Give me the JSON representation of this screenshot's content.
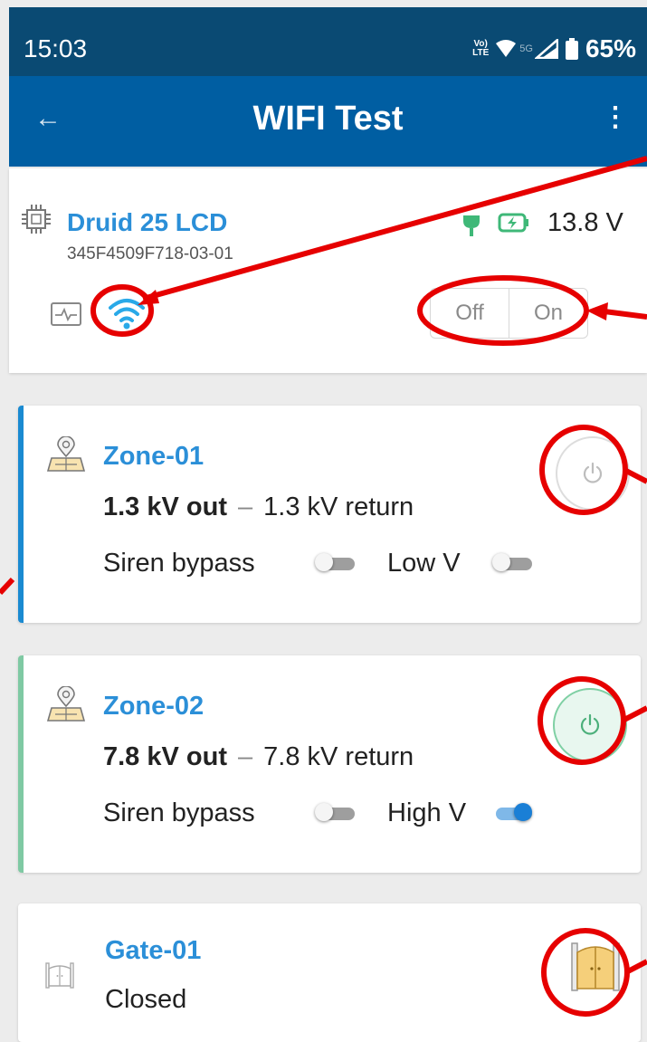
{
  "status_bar": {
    "time": "15:03",
    "volte": "Vo LTE",
    "net": "5G",
    "battery": "65%"
  },
  "app_bar": {
    "title": "WIFI Test",
    "back_icon": "arrow-left-icon",
    "menu_icon": "more-vert-icon"
  },
  "device": {
    "name": "Druid 25 LCD",
    "id": "345F4509F718-03-01",
    "voltage": "13.8 V",
    "segment": {
      "off": "Off",
      "on": "On"
    }
  },
  "zones": [
    {
      "name": "Zone-01",
      "out": "1.3 kV out",
      "dash": "–",
      "ret": "1.3 kV return",
      "opt1": "Siren bypass",
      "opt2": "Low V",
      "opt1_on": false,
      "opt2_on": false,
      "power": "off",
      "accent": "#1a8ad1"
    },
    {
      "name": "Zone-02",
      "out": "7.8 kV out",
      "dash": "–",
      "ret": "7.8 kV return",
      "opt1": "Siren bypass",
      "opt2": "High V",
      "opt1_on": false,
      "opt2_on": true,
      "power": "on",
      "accent": "#7fc9a3"
    }
  ],
  "gate": {
    "name": "Gate-01",
    "status": "Closed"
  },
  "colors": {
    "appbar": "#005ea2",
    "statusbar": "#0a4a73",
    "link": "#2b8fd8",
    "annotation": "#e60000"
  }
}
